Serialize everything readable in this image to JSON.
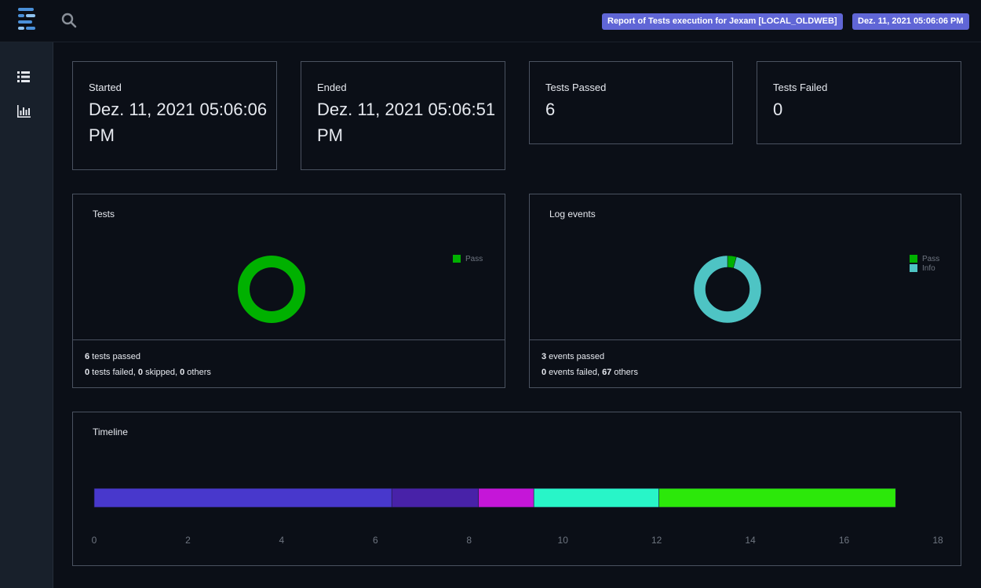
{
  "header": {
    "report_title": "Report of Tests execution for Jexam [LOCAL_OLDWEB]",
    "timestamp": "Dez. 11, 2021 05:06:06 PM",
    "icons": [
      "logo-icon",
      "search-icon"
    ]
  },
  "sidebar": {
    "items": [
      {
        "icon": "list-icon",
        "label": ""
      },
      {
        "icon": "bar-chart-icon",
        "label": ""
      }
    ]
  },
  "stats": {
    "started": {
      "label": "Started",
      "value": "Dez. 11, 2021 05:06:06 PM"
    },
    "ended": {
      "label": "Ended",
      "value": "Dez. 11, 2021 05:06:51 PM"
    },
    "passed": {
      "label": "Tests Passed",
      "value": "6"
    },
    "failed": {
      "label": "Tests Failed",
      "value": "0"
    }
  },
  "tests_card": {
    "title": "Tests",
    "passed_count": "6",
    "passed_text": " tests passed",
    "failed_count": "0",
    "failed_text": " tests failed, ",
    "skipped_count": "0",
    "skipped_text": " skipped, ",
    "others_count": "0",
    "others_text": " others"
  },
  "log_card": {
    "title": "Log events",
    "passed_count": "3",
    "passed_text": " events passed",
    "failed_count": "0",
    "failed_text": " events failed, ",
    "others_count": "67",
    "others_text": " others"
  },
  "timeline": {
    "title": "Timeline"
  },
  "chart_data": [
    {
      "type": "pie",
      "title": "Tests",
      "donut": true,
      "legend_position": "top-right",
      "series": [
        {
          "name": "Pass",
          "value": 6,
          "color": "#00b100"
        }
      ]
    },
    {
      "type": "pie",
      "title": "Log events",
      "donut": true,
      "legend_position": "top-right",
      "series": [
        {
          "name": "Pass",
          "value": 3,
          "color": "#00b100"
        },
        {
          "name": "Info",
          "value": 67,
          "color": "#4ec4c4"
        }
      ]
    },
    {
      "type": "bar",
      "orientation": "horizontal-stacked",
      "title": "Timeline",
      "xlim": [
        0,
        18
      ],
      "xticks": [
        "0",
        "2",
        "4",
        "6",
        "8",
        "10",
        "12",
        "14",
        "16",
        "18"
      ],
      "segments": [
        {
          "start": 0,
          "end": 6.35,
          "color": "#4838cc"
        },
        {
          "start": 6.35,
          "end": 8.2,
          "color": "#4822a8"
        },
        {
          "start": 8.2,
          "end": 9.38,
          "color": "#c516d8"
        },
        {
          "start": 9.38,
          "end": 12.05,
          "color": "#28f5c8"
        },
        {
          "start": 12.05,
          "end": 17.1,
          "color": "#2ce80a"
        }
      ]
    }
  ]
}
